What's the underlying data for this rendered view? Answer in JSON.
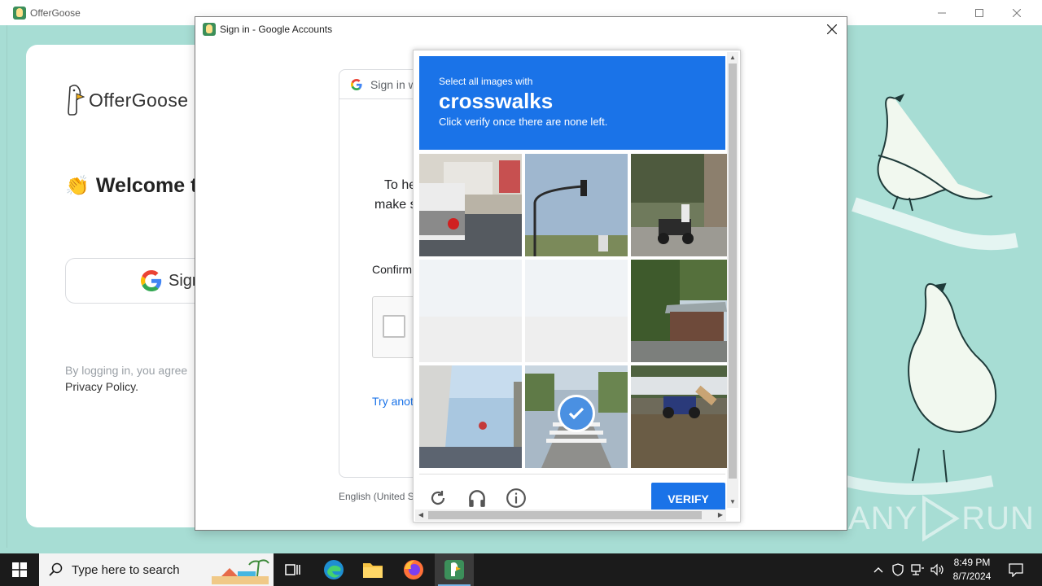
{
  "main_window": {
    "title": "OfferGoose",
    "logo_text": "OfferGoose",
    "welcome_text": "Welcome t",
    "sign_button_label": "Sign",
    "legal_line1": "By logging in, you agree",
    "legal_line2": "Privacy Policy."
  },
  "dialog": {
    "title": "Sign in - Google Accounts",
    "card_header": "Sign in w",
    "body_line1": "To he",
    "body_line2": "make s",
    "confirm_label": "Confirm",
    "try_link": "Try anot",
    "language": "English (United S"
  },
  "recaptcha": {
    "instruction_small": "Select all images with",
    "target": "crosswalks",
    "instruction_sub": "Click verify once there are none left.",
    "verify_label": "VERIFY",
    "tiles": [
      {
        "scene": "truck-street",
        "state": "normal"
      },
      {
        "scene": "traffic-light",
        "state": "normal"
      },
      {
        "scene": "motorbikes-wall",
        "state": "normal"
      },
      {
        "scene": "faded-road",
        "state": "loading"
      },
      {
        "scene": "faded-road",
        "state": "loading"
      },
      {
        "scene": "house-trees",
        "state": "normal"
      },
      {
        "scene": "overpass",
        "state": "normal"
      },
      {
        "scene": "crosswalk",
        "state": "selected"
      },
      {
        "scene": "motorbike-roadside",
        "state": "normal"
      }
    ],
    "footer_icons": [
      "reload-icon",
      "audio-icon",
      "info-icon"
    ],
    "accent_color": "#1a73e8"
  },
  "watermark": {
    "text_left": "ANY",
    "text_right": "RUN"
  },
  "taskbar": {
    "search_placeholder": "Type here to search",
    "apps": [
      "task-view-icon",
      "edge-icon",
      "file-explorer-icon",
      "firefox-icon",
      "offergoose-icon"
    ],
    "time": "8:49 PM",
    "date": "8/7/2024"
  }
}
